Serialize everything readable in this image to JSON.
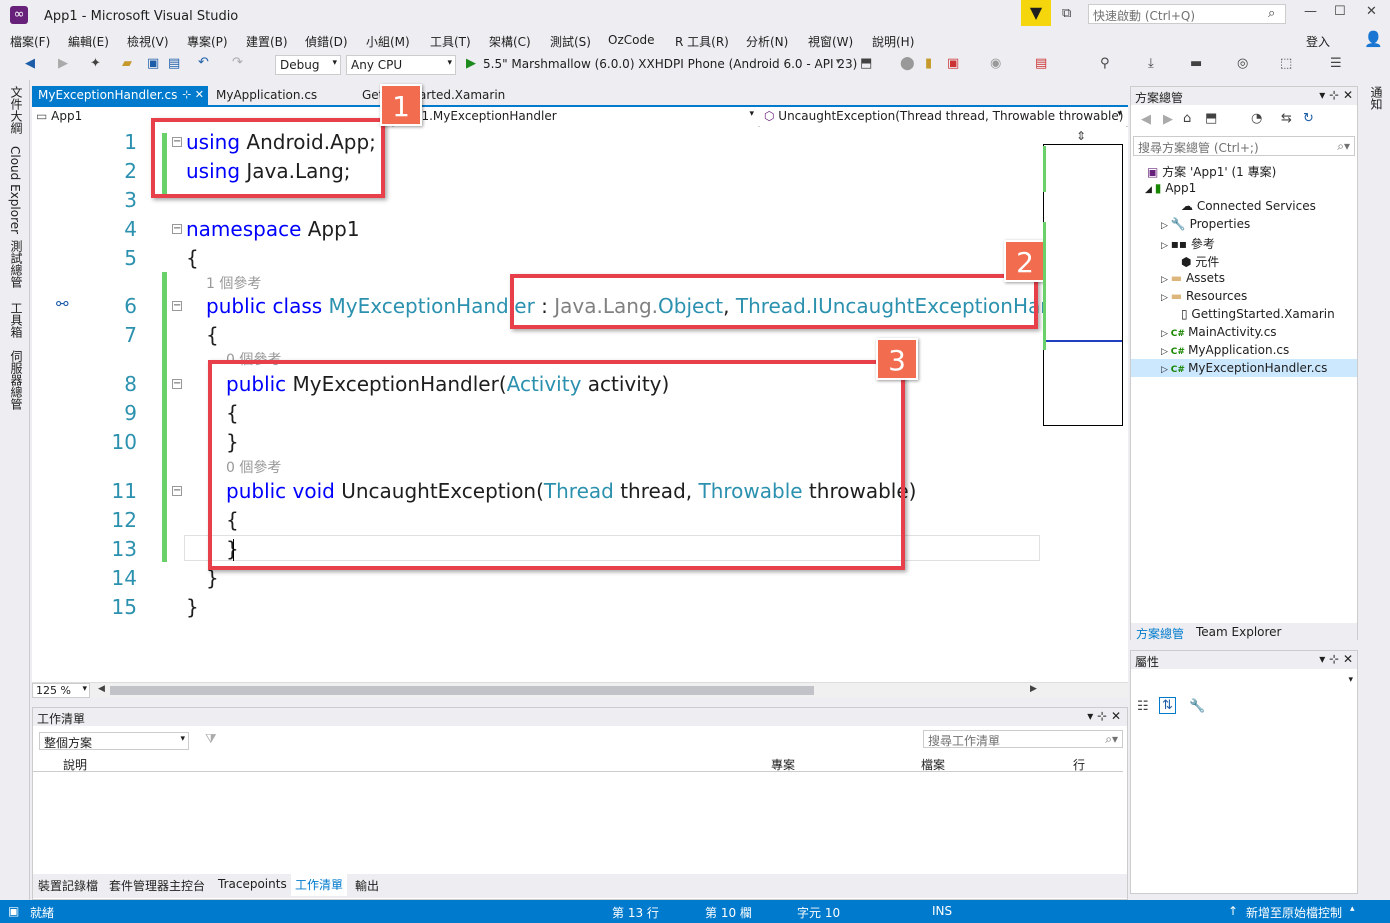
{
  "window": {
    "title": "App1 - Microsoft Visual Studio",
    "quick_launch": "快速啟動 (Ctrl+Q)",
    "signin": "登入"
  },
  "menu": [
    "檔案(F)",
    "編輯(E)",
    "檢視(V)",
    "專案(P)",
    "建置(B)",
    "偵錯(D)",
    "小組(M)",
    "工具(T)",
    "架構(C)",
    "測試(S)",
    "OzCode",
    "R 工具(R)",
    "分析(N)",
    "視窗(W)",
    "說明(H)"
  ],
  "toolbar": {
    "config": "Debug",
    "platform": "Any CPU",
    "run_target": "5.5\" Marshmallow (6.0.0) XXHDPI Phone (Android 6.0 - API 23)"
  },
  "left_rail": [
    "文件大綱",
    "Cloud Explorer",
    "測試總管",
    "工具箱",
    "伺服器總管"
  ],
  "right_rail": [
    "通知"
  ],
  "tabs": [
    {
      "label": "MyExceptionHandler.cs",
      "pin": "⊹ ✕"
    },
    {
      "label": "MyApplication.cs"
    },
    {
      "label": "GettingStarted.Xamarin"
    }
  ],
  "navbar": {
    "project": "App1",
    "class": "App1.MyExceptionHandler",
    "member": "UncaughtException(Thread thread, Throwable throwable)"
  },
  "code": {
    "line_numbers": [
      "1",
      "2",
      "3",
      "4",
      "5",
      "6",
      "7",
      "8",
      "9",
      "10",
      "11",
      "12",
      "13",
      "14",
      "15"
    ],
    "using1_kw": "using",
    "using1_rest": " Android.App;",
    "using2_kw": "using",
    "using2_rest": " Java.Lang;",
    "ns_kw": "namespace",
    "ns_rest": " App1",
    "brace_open": "{",
    "brace_close": "}",
    "ref_class": "1 個參考",
    "class_kw": "public class ",
    "class_name": "MyExceptionHandler",
    "class_colon": " : ",
    "base1_ns": "Java.Lang.",
    "base1": "Object",
    "comma": ", ",
    "base2_ns": "Thread.",
    "base2": "IUncaughtExceptionHandler",
    "ref_ctor": "0 個參考",
    "ctor_kw": "public ",
    "ctor_name": "MyExceptionHandler(",
    "ctor_ptype": "Activity",
    "ctor_rest": " activity)",
    "ref_method": "0 個參考",
    "method_kw": "public void ",
    "method_name": "UncaughtException(",
    "method_t1": "Thread",
    "method_p1": " thread, ",
    "method_t2": "Throwable",
    "method_p2": " throwable)"
  },
  "badges": [
    "1",
    "2",
    "3"
  ],
  "zoom": "125 %",
  "task_list": {
    "title": "工作清單",
    "scope": "整個方案",
    "search": "搜尋工作清單",
    "columns": [
      "說明",
      "專案",
      "檔案",
      "行"
    ]
  },
  "bottom_tabs": [
    "裝置記錄檔",
    "套件管理器主控台",
    "Tracepoints",
    "工作清單",
    "輸出"
  ],
  "solution_explorer": {
    "title": "方案總管",
    "search": "搜尋方案總管 (Ctrl+;)",
    "items": [
      {
        "label": "方案 'App1' (1 專案)"
      },
      {
        "label": "App1"
      },
      {
        "label": "Connected Services"
      },
      {
        "label": "Properties"
      },
      {
        "label": "參考"
      },
      {
        "label": "元件"
      },
      {
        "label": "Assets"
      },
      {
        "label": "Resources"
      },
      {
        "label": "GettingStarted.Xamarin"
      },
      {
        "label": "MainActivity.cs"
      },
      {
        "label": "MyApplication.cs"
      },
      {
        "label": "MyExceptionHandler.cs"
      }
    ],
    "tabs": [
      "方案總管",
      "Team Explorer"
    ]
  },
  "properties": {
    "title": "屬性"
  },
  "status": {
    "ready": "就緒",
    "line": "第 13 行",
    "col": "第 10 欄",
    "char": "字元 10",
    "mode": "INS",
    "source_control": "新增至原始檔控制"
  },
  "colors": {
    "accent": "#007acc",
    "annotation": "#e8404a",
    "badge": "#f26d4f"
  }
}
